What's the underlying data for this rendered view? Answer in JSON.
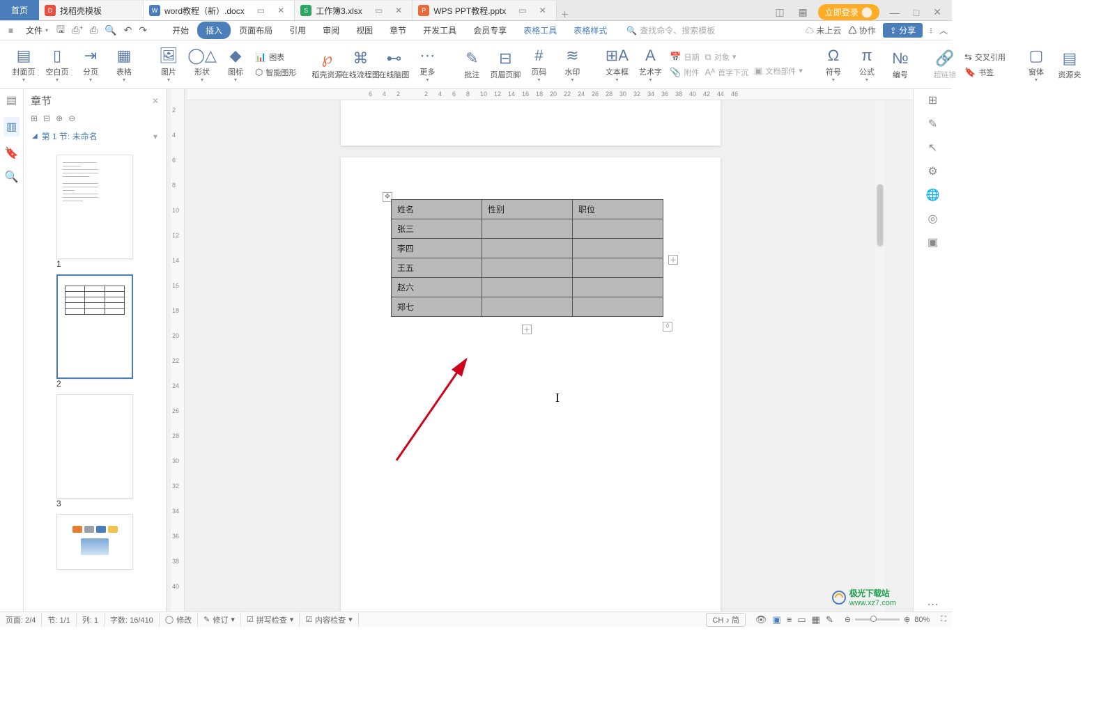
{
  "tabs": {
    "home": "首页",
    "items": [
      {
        "icon_bg": "#e84d3d",
        "icon_text": "D",
        "label": "找稻壳模板"
      },
      {
        "icon_bg": "#4a7ebb",
        "icon_text": "W",
        "label": "word教程（新）.docx",
        "active": true
      },
      {
        "icon_bg": "#2aa562",
        "icon_text": "S",
        "label": "工作簿3.xlsx"
      },
      {
        "icon_bg": "#e96b3c",
        "icon_text": "P",
        "label": "WPS PPT教程.pptx"
      }
    ],
    "login": "立即登录"
  },
  "quick_access": {
    "file": "文件"
  },
  "menu": {
    "items": [
      "开始",
      "插入",
      "页面布局",
      "引用",
      "审阅",
      "视图",
      "章节",
      "开发工具",
      "会员专享"
    ],
    "context": [
      "表格工具",
      "表格样式"
    ],
    "active": "插入",
    "search_placeholder": "查找命令、搜索模板",
    "cloud": "未上云",
    "coop": "协作",
    "share": "分享"
  },
  "ribbon": {
    "cover": "封面页",
    "blank": "空白页",
    "page_break": "分页",
    "table": "表格",
    "picture": "图片",
    "shape": "形状",
    "icon": "图标",
    "chart": "图表",
    "smart": "智能图形",
    "daoke": "稻壳资源",
    "flow": "在线流程图",
    "mind": "在线脑图",
    "more": "更多",
    "comment": "批注",
    "headerfooter": "页眉页脚",
    "pagenum": "页码",
    "watermark": "水印",
    "textbox": "文本框",
    "wordart": "艺术字",
    "date": "日期",
    "attach": "附件",
    "object": "对象",
    "first_drop": "首字下沉",
    "doc_part": "文档部件",
    "symbol": "符号",
    "formula": "公式",
    "number": "编号",
    "hyperlink": "超链接",
    "cross": "交叉引用",
    "bookmark": "书签",
    "window": "窗体",
    "resource": "资源夹"
  },
  "chapter": {
    "title": "章节",
    "section": "第 1 节: 未命名",
    "pages": [
      "1",
      "2",
      "3"
    ]
  },
  "doc_table": {
    "headers": [
      "姓名",
      "性别",
      "职位"
    ],
    "rows": [
      "张三",
      "李四",
      "王五",
      "赵六",
      "郑七"
    ]
  },
  "hruler_ticks": [
    "6",
    "4",
    "2",
    "",
    "2",
    "4",
    "6",
    "8",
    "10",
    "12",
    "14",
    "16",
    "18",
    "20",
    "22",
    "24",
    "26",
    "28",
    "30",
    "32",
    "34",
    "36",
    "38",
    "40",
    "42",
    "44",
    "46"
  ],
  "vruler_ticks": [
    "2",
    "4",
    "6",
    "8",
    "10",
    "12",
    "14",
    "16",
    "18",
    "20",
    "22",
    "24",
    "26",
    "28",
    "30",
    "32",
    "34",
    "36",
    "38",
    "40"
  ],
  "status": {
    "page": "页面: 2/4",
    "section": "节: 1/1",
    "col": "列: 1",
    "words": "字数: 16/410",
    "revise": "修改",
    "revision": "修订",
    "spell": "拼写检查",
    "content": "内容检查",
    "ime": "CH ♪ 简",
    "zoom": "80%"
  },
  "watermark": {
    "brand": "极光下载站",
    "url": "www.xz7.com"
  }
}
